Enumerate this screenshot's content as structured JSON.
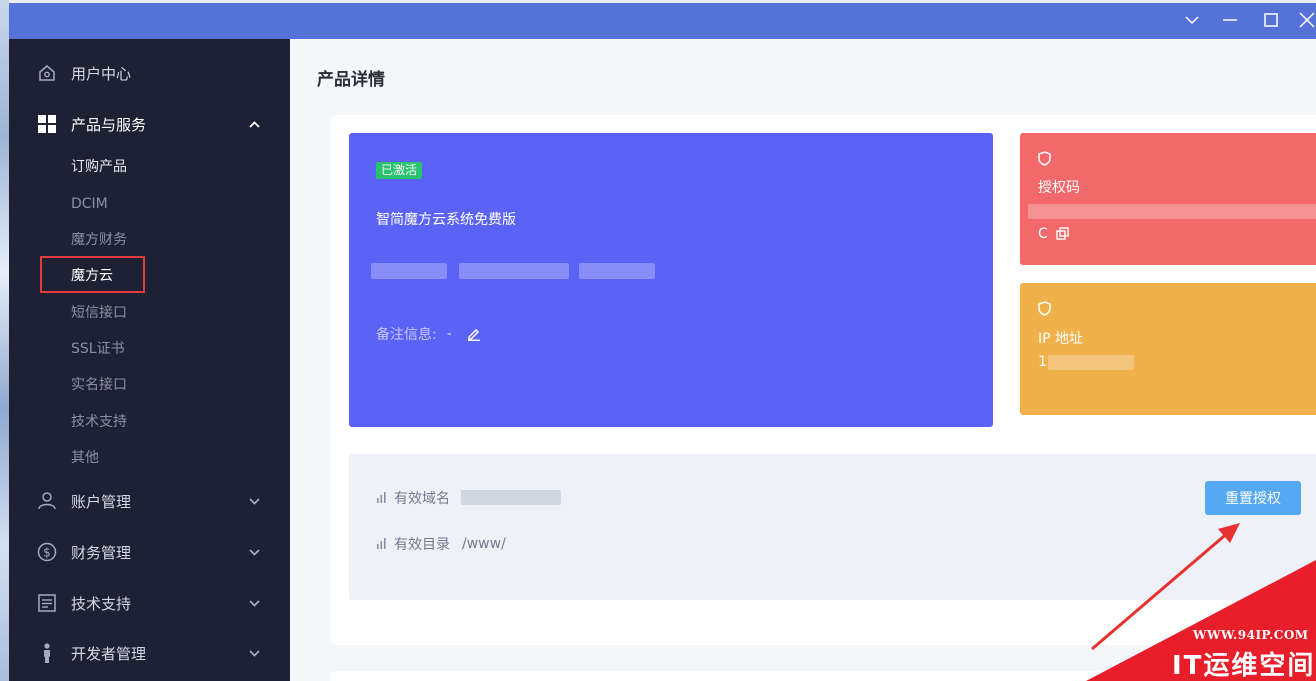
{
  "window": {
    "controls": [
      "﹀",
      "—",
      "☐",
      "✕"
    ]
  },
  "sidebar": {
    "groups": [
      {
        "label": "用户中心",
        "icon": "home-icon"
      },
      {
        "label": "产品与服务",
        "icon": "grid-icon"
      },
      {
        "label": "账户管理",
        "icon": "user-icon"
      },
      {
        "label": "财务管理",
        "icon": "dollar-icon"
      },
      {
        "label": "技术支持",
        "icon": "document-icon"
      },
      {
        "label": "开发者管理",
        "icon": "developer-icon"
      }
    ],
    "sub_items": [
      "订购产品",
      "DCIM",
      "魔方财务",
      "魔方云",
      "短信接口",
      "SSL证书",
      "实名接口",
      "技术支持",
      "其他"
    ]
  },
  "main": {
    "title": "产品详情",
    "product": {
      "status_badge": "已激活",
      "name": "智简魔方云系统免费版",
      "remark_label": "备注信息:",
      "remark_value": "-"
    },
    "license": {
      "label": "授权码",
      "value_prefix": "C"
    },
    "ip": {
      "label": "IP 地址",
      "value_prefix": "1"
    },
    "details": {
      "domain_label": "有效域名",
      "dir_label": "有效目录",
      "dir_value": "/www/",
      "reset_button": "重置授权"
    }
  },
  "watermark": {
    "url": "WWW.94IP.COM",
    "text": "IT运维空间"
  },
  "colors": {
    "titlebar": "#5671d8",
    "sidebar": "#1e2134",
    "product_card": "#5b63f7",
    "license_card": "#f2686b",
    "ip_card": "#f0b14b",
    "badge": "#28c36e",
    "button": "#55a8f2",
    "highlight": "#e23c3c"
  }
}
